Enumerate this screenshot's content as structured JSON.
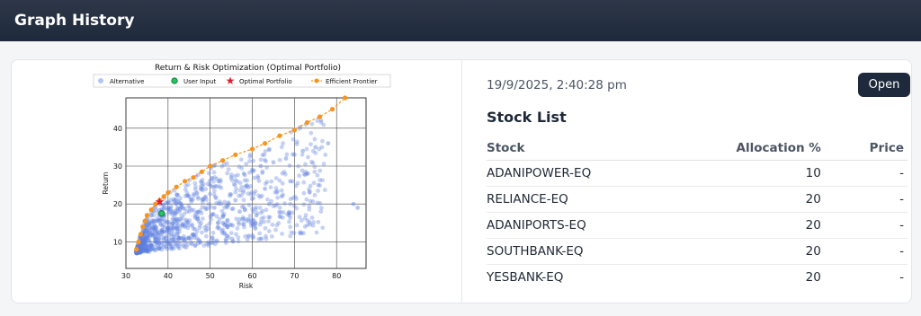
{
  "header": {
    "title": "Graph History"
  },
  "record": {
    "timestamp": "19/9/2025, 2:40:28 pm",
    "open_label": "Open",
    "stock_list_title": "Stock List",
    "columns": [
      "Stock",
      "Allocation %",
      "Price"
    ],
    "rows": [
      {
        "stock": "ADANIPOWER-EQ",
        "allocation": "10",
        "price": "-"
      },
      {
        "stock": "RELIANCE-EQ",
        "allocation": "20",
        "price": "-"
      },
      {
        "stock": "ADANIPORTS-EQ",
        "allocation": "20",
        "price": "-"
      },
      {
        "stock": "SOUTHBANK-EQ",
        "allocation": "20",
        "price": "-"
      },
      {
        "stock": "YESBANK-EQ",
        "allocation": "20",
        "price": "-"
      }
    ]
  },
  "colors": {
    "header_bg": "#1e293b",
    "button_bg": "#1e293b",
    "alternative": "#5b7fe0",
    "user_input": "#22c55e",
    "optimal": "#e11d2a",
    "frontier": "#f7931e"
  },
  "chart_data": {
    "type": "scatter",
    "title": "Return & Risk Optimization (Optimal Portfolio)",
    "xlabel": "Risk",
    "ylabel": "Return",
    "xlim": [
      30,
      87
    ],
    "ylim": [
      3,
      48
    ],
    "xticks": [
      30,
      40,
      50,
      60,
      70,
      80
    ],
    "yticks": [
      10,
      20,
      30,
      40
    ],
    "grid": true,
    "legend_position": "top",
    "legend": [
      "Alternative",
      "User Input",
      "Optimal Portfolio",
      "Efficient Frontier"
    ],
    "series": [
      {
        "name": "Efficient Frontier",
        "x": [
          32.5,
          33,
          33.5,
          34,
          34.5,
          35,
          36,
          37,
          38,
          39,
          40,
          42,
          44,
          46,
          48,
          50,
          53,
          56,
          60,
          63,
          66.5,
          70,
          73,
          76,
          79,
          82
        ],
        "y": [
          8,
          10,
          12,
          14,
          15.5,
          17,
          18.5,
          20,
          21,
          22,
          23,
          24.5,
          26,
          27,
          28.5,
          30,
          31.5,
          33,
          34.5,
          36,
          38,
          39.5,
          41.5,
          43,
          45,
          48
        ]
      },
      {
        "name": "User Input",
        "x": [
          38.5
        ],
        "y": [
          17.5
        ]
      },
      {
        "name": "Optimal Portfolio",
        "x": [
          38
        ],
        "y": [
          20.5
        ]
      },
      {
        "name": "Alternative",
        "x": [
          34,
          36,
          38,
          40,
          42,
          45,
          48,
          50,
          52,
          55,
          58,
          60,
          62,
          65,
          68,
          70,
          72,
          75,
          78,
          84,
          85,
          44,
          47,
          53,
          57,
          61,
          64,
          67,
          40,
          43,
          46,
          49,
          54,
          59,
          36,
          39,
          41,
          35,
          37,
          42,
          51,
          56,
          63,
          69,
          73
        ],
        "y": [
          12,
          15,
          17,
          19,
          20,
          22,
          24,
          25,
          26,
          27,
          28,
          29,
          30,
          31,
          32,
          33,
          34,
          35,
          36,
          20,
          19,
          14,
          16,
          15,
          18,
          17,
          20,
          22,
          10,
          11,
          12,
          13,
          14,
          16,
          9,
          11,
          13,
          8,
          10,
          15,
          19,
          21,
          24,
          26,
          28
        ]
      }
    ]
  }
}
